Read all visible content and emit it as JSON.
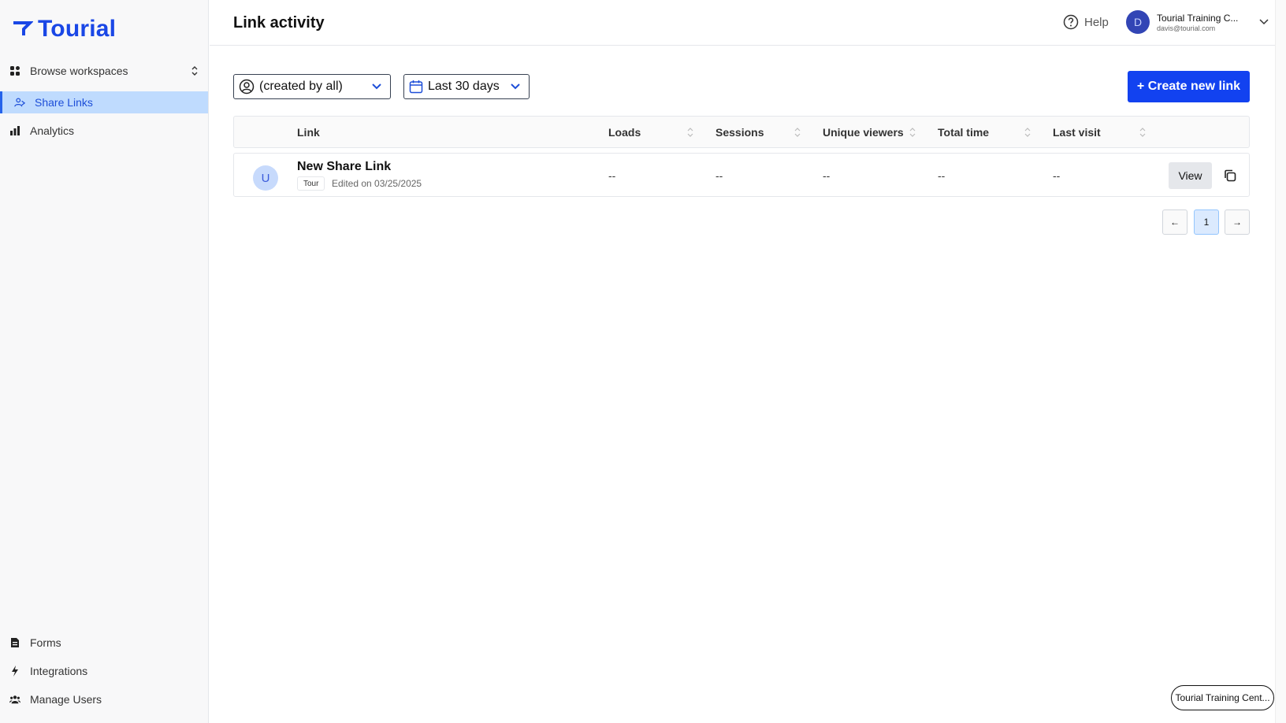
{
  "brand": {
    "logo_text": "Tourial",
    "accent": "#1a47e6"
  },
  "sidebar": {
    "workspace_switcher": "Browse workspaces",
    "items": [
      {
        "label": "Share Links",
        "icon": "share-users-icon",
        "active": true
      },
      {
        "label": "Analytics",
        "icon": "bar-chart-icon",
        "active": false
      }
    ],
    "bottom_items": [
      {
        "label": "Forms",
        "icon": "document-icon"
      },
      {
        "label": "Integrations",
        "icon": "bolt-icon"
      },
      {
        "label": "Manage Users",
        "icon": "users-icon"
      }
    ]
  },
  "header": {
    "title": "Link activity",
    "help_label": "Help",
    "user": {
      "initial": "D",
      "name": "Tourial Training C...",
      "email": "davis@tourial.com"
    }
  },
  "filters": {
    "creator": "(created by all)",
    "date_range": "Last 30 days",
    "create_label": "+ Create new link"
  },
  "table": {
    "columns": [
      "Link",
      "Loads",
      "Sessions",
      "Unique viewers",
      "Total time",
      "Last visit"
    ],
    "rows": [
      {
        "avatar": "U",
        "title": "New Share Link",
        "tag": "Tour",
        "edited": "Edited on 03/25/2025",
        "loads": "--",
        "sessions": "--",
        "unique_viewers": "--",
        "total_time": "--",
        "last_visit": "--",
        "view_label": "View"
      }
    ]
  },
  "pagination": {
    "prev": "←",
    "current": "1",
    "next": "→"
  },
  "org_pill": "Tourial Training Cent..."
}
